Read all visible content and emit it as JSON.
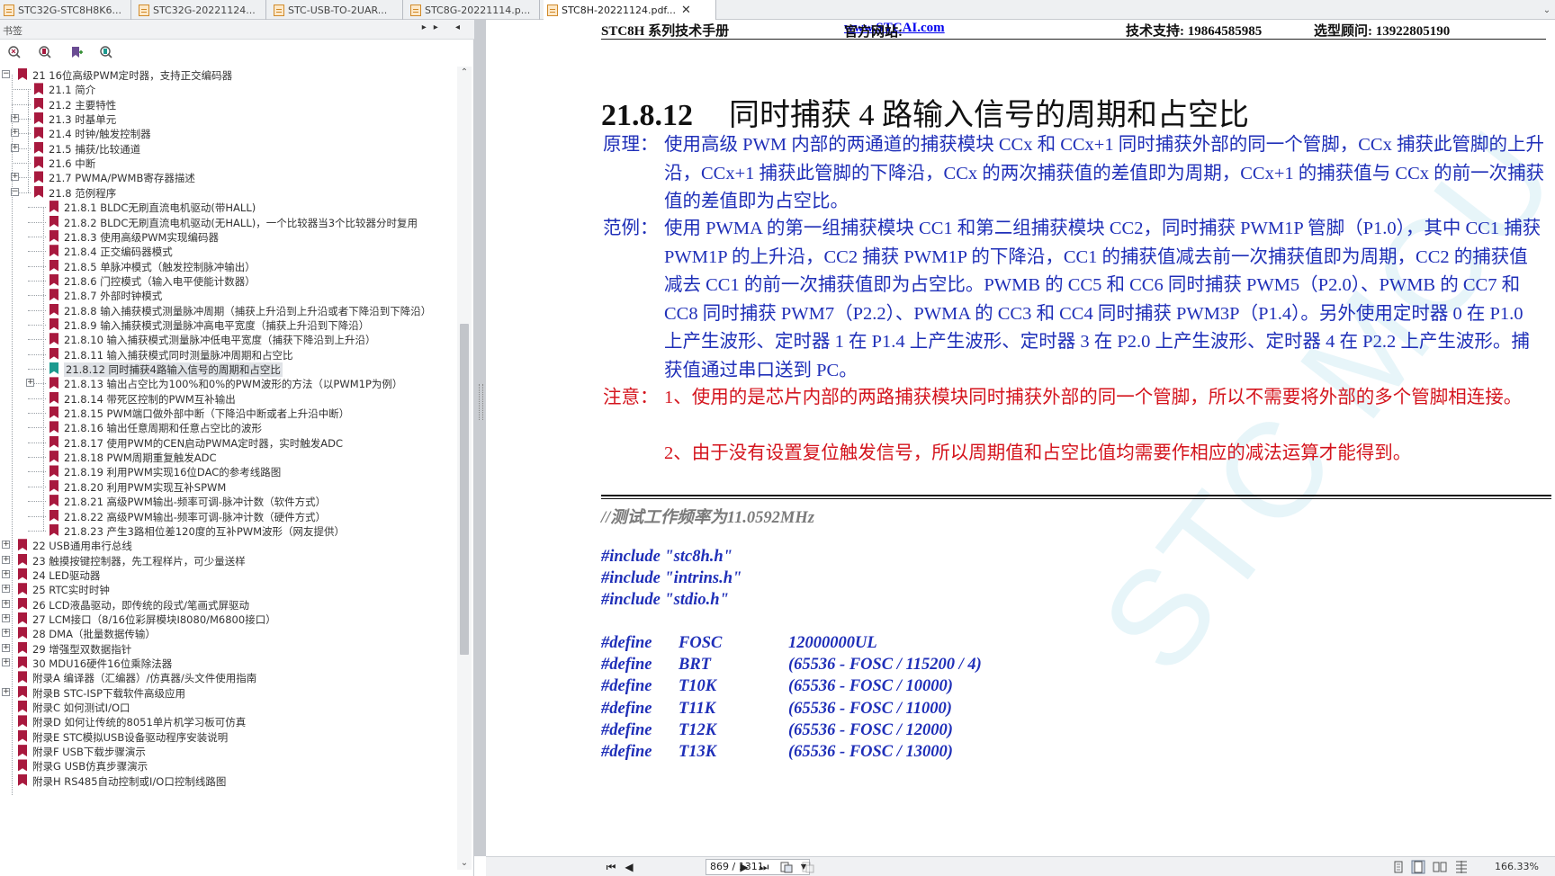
{
  "tabs": [
    {
      "label": "STC32G-STC8H8K6..."
    },
    {
      "label": "STC32G-20221124..."
    },
    {
      "label": "STC-USB-TO-2UAR..."
    },
    {
      "label": "STC8G-20221114.p..."
    },
    {
      "label": "STC8H-20221124.pdf...",
      "close": "✕"
    }
  ],
  "bookmark_panel": {
    "title": "书签",
    "controls": "▸▸ ◂",
    "tree": [
      {
        "label": "21 16位高级PWM定时器，支持正交编码器",
        "level": 0,
        "expander": "−"
      },
      {
        "label": "21.1 简介",
        "level": 1
      },
      {
        "label": "21.2 主要特性",
        "level": 1
      },
      {
        "label": "21.3 时基单元",
        "level": 1,
        "expander": "+"
      },
      {
        "label": "21.4 时钟/触发控制器",
        "level": 1,
        "expander": "+"
      },
      {
        "label": "21.5 捕获/比较通道",
        "level": 1,
        "expander": "+"
      },
      {
        "label": "21.6 中断",
        "level": 1
      },
      {
        "label": "21.7 PWMA/PWMB寄存器描述",
        "level": 1,
        "expander": "+"
      },
      {
        "label": "21.8 范例程序",
        "level": 1,
        "expander": "−"
      },
      {
        "label": "21.8.1 BLDC无刷直流电机驱动(带HALL)",
        "level": 2
      },
      {
        "label": "21.8.2 BLDC无刷直流电机驱动(无HALL)，一个比较器当3个比较器分时复用",
        "level": 2
      },
      {
        "label": "21.8.3 使用高级PWM实现编码器",
        "level": 2
      },
      {
        "label": "21.8.4 正交编码器模式",
        "level": 2
      },
      {
        "label": "21.8.5 单脉冲模式（触发控制脉冲输出）",
        "level": 2
      },
      {
        "label": "21.8.6 门控模式（输入电平使能计数器）",
        "level": 2
      },
      {
        "label": "21.8.7 外部时钟模式",
        "level": 2
      },
      {
        "label": "21.8.8 输入捕获模式测量脉冲周期（捕获上升沿到上升沿或者下降沿到下降沿）",
        "level": 2
      },
      {
        "label": "21.8.9 输入捕获模式测量脉冲高电平宽度（捕获上升沿到下降沿）",
        "level": 2
      },
      {
        "label": "21.8.10 输入捕获模式测量脉冲低电平宽度（捕获下降沿到上升沿）",
        "level": 2
      },
      {
        "label": "21.8.11 输入捕获模式同时测量脉冲周期和占空比",
        "level": 2
      },
      {
        "label": "21.8.12 同时捕获4路输入信号的周期和占空比",
        "level": 2,
        "selected": true
      },
      {
        "label": "21.8.13 输出占空比为100%和0%的PWM波形的方法（以PWM1P为例）",
        "level": 2,
        "expander": "+"
      },
      {
        "label": "21.8.14 带死区控制的PWM互补输出",
        "level": 2
      },
      {
        "label": "21.8.15 PWM端口做外部中断（下降沿中断或者上升沿中断）",
        "level": 2
      },
      {
        "label": "21.8.16 输出任意周期和任意占空比的波形",
        "level": 2
      },
      {
        "label": "21.8.17 使用PWM的CEN启动PWMA定时器，实时触发ADC",
        "level": 2
      },
      {
        "label": "21.8.18 PWM周期重复触发ADC",
        "level": 2
      },
      {
        "label": "21.8.19 利用PWM实现16位DAC的参考线路图",
        "level": 2
      },
      {
        "label": "21.8.20 利用PWM实现互补SPWM",
        "level": 2
      },
      {
        "label": "21.8.21 高级PWM输出-频率可调-脉冲计数（软件方式）",
        "level": 2
      },
      {
        "label": "21.8.22 高级PWM输出-频率可调-脉冲计数（硬件方式）",
        "level": 2
      },
      {
        "label": "21.8.23 产生3路相位差120度的互补PWM波形（网友提供）",
        "level": 2
      },
      {
        "label": "22 USB通用串行总线",
        "level": 0,
        "expander": "+"
      },
      {
        "label": "23 触摸按键控制器，先工程样片，可少量送样",
        "level": 0,
        "expander": "+"
      },
      {
        "label": "24 LED驱动器",
        "level": 0,
        "expander": "+"
      },
      {
        "label": "25 RTC实时时钟",
        "level": 0,
        "expander": "+"
      },
      {
        "label": "26 LCD液晶驱动，即传统的段式/笔画式屏驱动",
        "level": 0,
        "expander": "+"
      },
      {
        "label": "27 LCM接口（8/16位彩屏模块I8080/M6800接口）",
        "level": 0,
        "expander": "+"
      },
      {
        "label": "28 DMA（批量数据传输）",
        "level": 0,
        "expander": "+"
      },
      {
        "label": "29 增强型双数据指针",
        "level": 0,
        "expander": "+"
      },
      {
        "label": "30 MDU16硬件16位乘除法器",
        "level": 0,
        "expander": "+"
      },
      {
        "label": "附录A 编译器（汇编器）/仿真器/头文件使用指南",
        "level": 0
      },
      {
        "label": "附录B STC-ISP下载软件高级应用",
        "level": 0,
        "expander": "+"
      },
      {
        "label": "附录C 如何测试I/O口",
        "level": 0
      },
      {
        "label": "附录D 如何让传统的8051单片机学习板可仿真",
        "level": 0
      },
      {
        "label": "附录E STC模拟USB设备驱动程序安装说明",
        "level": 0
      },
      {
        "label": "附录F USB下载步骤演示",
        "level": 0
      },
      {
        "label": "附录G USB仿真步骤演示",
        "level": 0
      },
      {
        "label": "附录H RS485自动控制或I/O口控制线路图",
        "level": 0
      }
    ]
  },
  "document": {
    "header": {
      "manual": "STC8H 系列技术手册",
      "site_label": "官方网站: ",
      "site_url": "www.STCAI.com",
      "support": "技术支持: 19864585985",
      "consultant": "选型顾问: 13922805190"
    },
    "section_number": "21.8.12",
    "section_title": "同时捕获 4 路输入信号的周期和占空比",
    "principle": {
      "tag": "原理：",
      "text": "使用高级 PWM 内部的两通道的捕获模块 CCx 和 CCx+1 同时捕获外部的同一个管脚，CCx 捕获此管脚的上升沿，CCx+1 捕获此管脚的下降沿，CCx 的两次捕获值的差值即为周期，CCx+1 的捕获值与 CCx 的前一次捕获值的差值即为占空比。"
    },
    "example": {
      "tag": "范例：",
      "text": "使用 PWMA 的第一组捕获模块 CC1 和第二组捕获模块 CC2，同时捕获 PWM1P 管脚（P1.0），其中 CC1 捕获 PWM1P 的上升沿，CC2 捕获 PWM1P 的下降沿，CC1 的捕获值减去前一次捕获值即为周期，CC2 的捕获值减去 CC1 的前一次捕获值即为占空比。PWMB 的 CC5 和 CC6 同时捕获 PWM5（P2.0）、PWMB 的 CC7 和 CC8 同时捕获 PWM7（P2.2）、PWMA 的 CC3 和 CC4 同时捕获 PWM3P（P1.4）。另外使用定时器 0 在 P1.0 上产生波形、定时器 1 在 P1.4 上产生波形、定时器 3 在 P2.0 上产生波形、定时器 4 在 P2.2 上产生波形。捕获值通过串口送到 PC。"
    },
    "note": {
      "tag": "注意：",
      "item1": "1、使用的是芯片内部的两路捕获模块同时捕获外部的同一个管脚，所以不需要将外部的多个管脚相连接。",
      "item2": "2、由于没有设置复位触发信号，所以周期值和占空比值均需要作相应的减法运算才能得到。"
    },
    "code": {
      "comment": "//测试工作频率为11.0592MHz",
      "includes": [
        "#include \"stc8h.h\"",
        "#include \"intrins.h\"",
        "#include \"stdio.h\""
      ],
      "defines": [
        {
          "kw": "#define",
          "name": "FOSC",
          "value": "12000000UL"
        },
        {
          "kw": "#define",
          "name": "BRT",
          "value": "(65536 - FOSC / 115200 / 4)"
        },
        {
          "kw": "#define",
          "name": "T10K",
          "value": "(65536 - FOSC / 10000)"
        },
        {
          "kw": "#define",
          "name": "T11K",
          "value": "(65536 - FOSC / 11000)"
        },
        {
          "kw": "#define",
          "name": "T12K",
          "value": "(65536 - FOSC / 12000)"
        },
        {
          "kw": "#define",
          "name": "T13K",
          "value": "(65536 - FOSC / 13000)"
        }
      ]
    },
    "watermark": "STC MCU"
  },
  "statusbar": {
    "first": "⏮",
    "prev": "◀",
    "page": "869 / 1311",
    "next": "▶",
    "last": "⏭",
    "zoom": "166.33%"
  },
  "colors": {
    "accent_blue": "#1f2fb8",
    "note_red": "#d4141d",
    "bookmark": "#a8193e"
  }
}
